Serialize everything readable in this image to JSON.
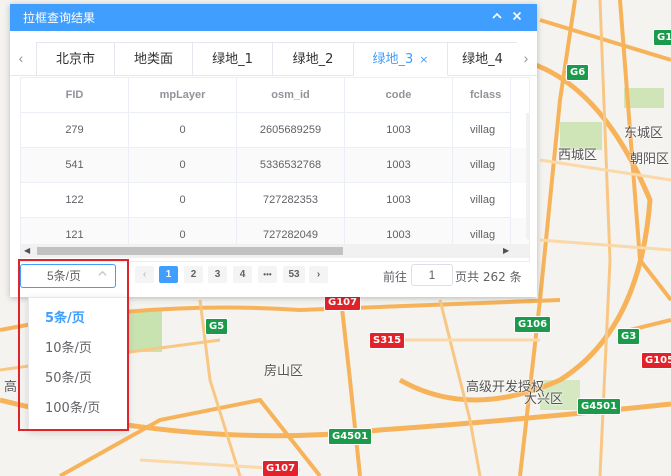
{
  "panel": {
    "title": "拉框查询结果",
    "collapse_icon": "chevron-up-icon",
    "close_icon": "close-icon"
  },
  "tabs": {
    "items": [
      {
        "label": "北京市"
      },
      {
        "label": "地类面"
      },
      {
        "label": "绿地_1"
      },
      {
        "label": "绿地_2"
      },
      {
        "label": "绿地_3",
        "active": true
      },
      {
        "label": "绿地_4"
      }
    ],
    "close_glyph": "×"
  },
  "table": {
    "columns": [
      "FID",
      "mpLayer",
      "osm_id",
      "code",
      "fclass"
    ],
    "rows": [
      [
        "279",
        "0",
        "2605689259",
        "1003",
        "villag"
      ],
      [
        "541",
        "0",
        "5336532768",
        "1003",
        "villag"
      ],
      [
        "122",
        "0",
        "727282353",
        "1003",
        "villag"
      ],
      [
        "121",
        "0",
        "727282049",
        "1003",
        "villag"
      ]
    ]
  },
  "pagination": {
    "page_size": "5条/页",
    "pages": [
      "1",
      "2",
      "3",
      "4",
      "•••",
      "53"
    ],
    "current": "1",
    "goto_label": "前往",
    "goto_value": "1",
    "total_label": "页共 262 条",
    "options": [
      "5条/页",
      "10条/页",
      "50条/页",
      "100条/页"
    ]
  },
  "map": {
    "labels": [
      "东城区",
      "西城区",
      "朝阳区",
      "房山区",
      "高级开发授权",
      "大兴区",
      "高"
    ],
    "shields": [
      "G6",
      "G5",
      "G106",
      "G3",
      "S315",
      "G107",
      "G4501",
      "G4501",
      "G107",
      "G105",
      "G1"
    ]
  },
  "colors": {
    "accent": "#409eff",
    "highlight_box": "#e0242c",
    "national_road_green": "#1a9a4a",
    "provincial_road_red": "#e2222a"
  }
}
